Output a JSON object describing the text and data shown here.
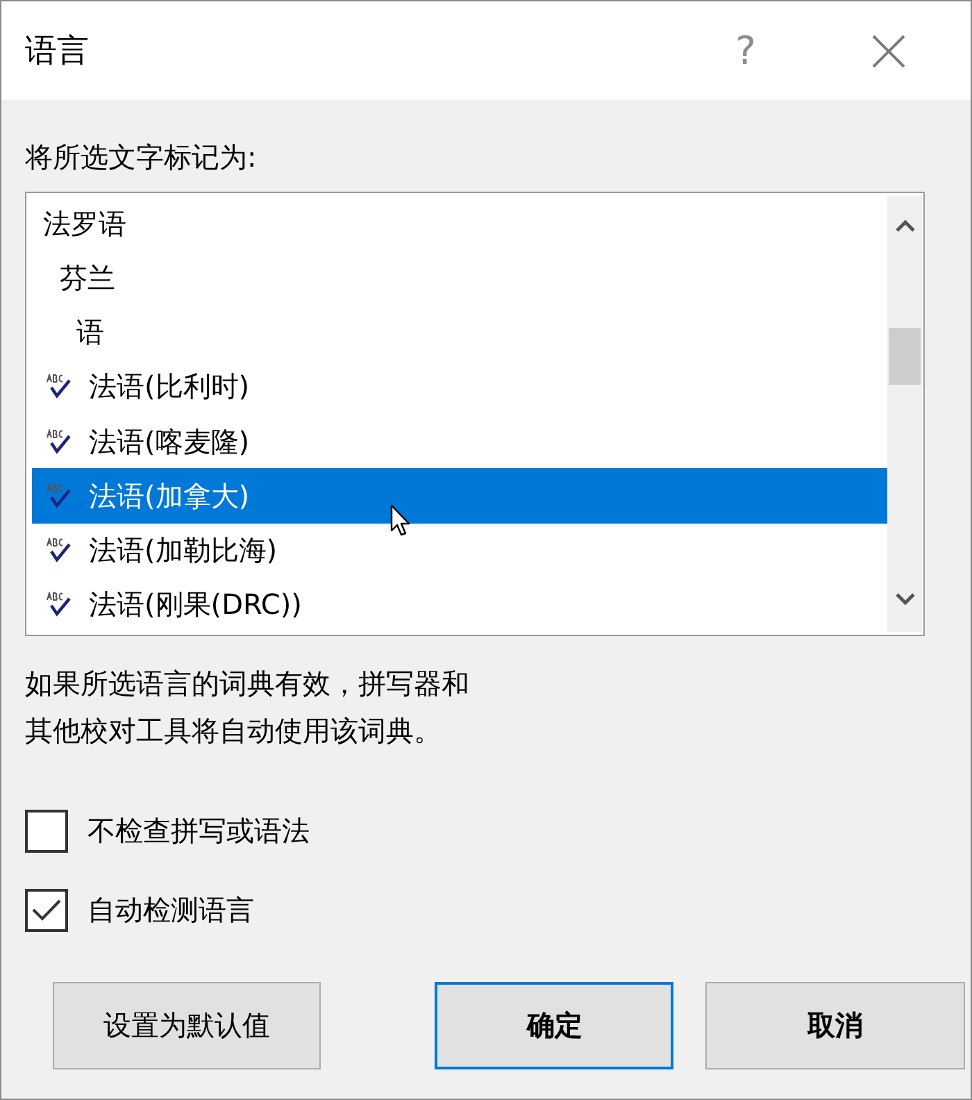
{
  "window": {
    "title": "语言",
    "help_button": "?"
  },
  "list_label": "将所选文字标记为:",
  "languages": [
    {
      "label": "法罗语",
      "kind": "plain",
      "selected": false
    },
    {
      "label": "芬兰",
      "kind": "plain",
      "selected": false
    },
    {
      "label": "语",
      "kind": "plain",
      "selected": false
    },
    {
      "label": "法语(比利时)",
      "kind": "proofing",
      "selected": false
    },
    {
      "label": "法语(喀麦隆)",
      "kind": "proofing",
      "selected": false
    },
    {
      "label": "法语(加拿大)",
      "kind": "proofing",
      "selected": true
    },
    {
      "label": "法语(加勒比海)",
      "kind": "proofing",
      "selected": false
    },
    {
      "label": "法语(刚果(DRC))",
      "kind": "proofing",
      "selected": false
    }
  ],
  "description": [
    "如果所选语言的词典有效，拼写器和",
    "其他校对工具将自动使用该词典。"
  ],
  "options": [
    {
      "label": "不检查拼写或语法",
      "checked": false
    },
    {
      "label": "自动检测语言",
      "checked": true
    }
  ],
  "buttons": [
    {
      "label": "设置为默认值",
      "default": false
    },
    {
      "label": "确定",
      "default": true
    },
    {
      "label": "取消",
      "default": false
    }
  ]
}
